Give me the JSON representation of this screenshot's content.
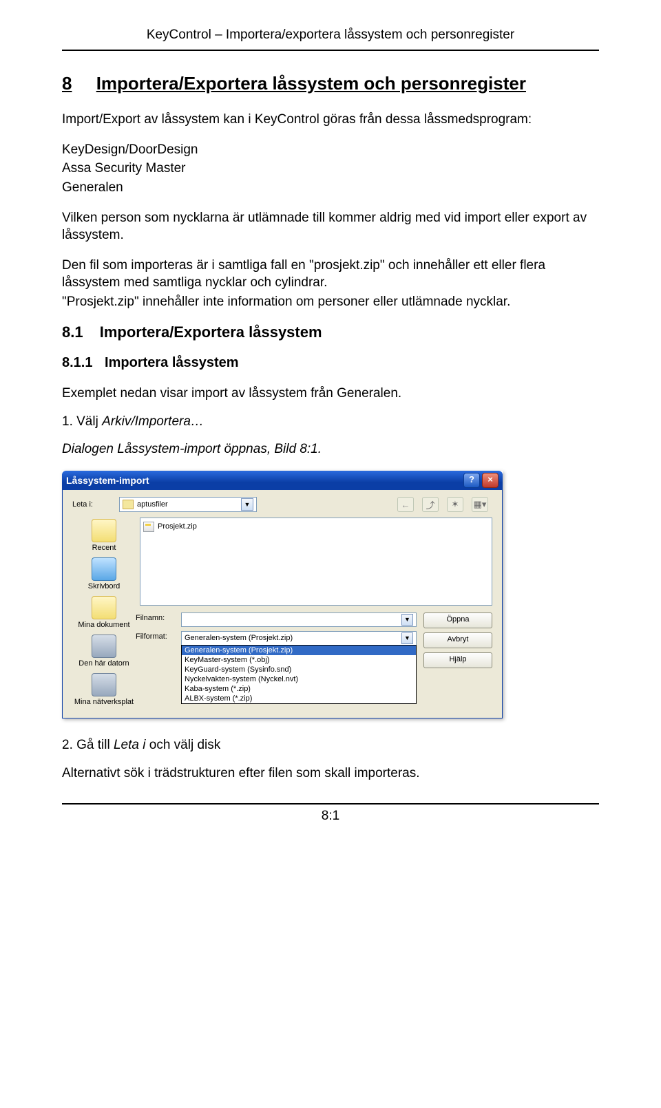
{
  "header": "KeyControl – Importera/exportera låssystem och personregister",
  "section": {
    "num": "8",
    "title": "Importera/Exportera låssystem och personregister"
  },
  "intro": "Import/Export av låssystem kan i KeyControl göras från dessa låssmedsprogram:",
  "programs": [
    "KeyDesign/DoorDesign",
    "Assa Security Master",
    "Generalen"
  ],
  "para2": "Vilken person som nycklarna är utlämnade till kommer aldrig med vid import eller export av låssystem.",
  "para3a": "Den fil som importeras är i samtliga fall en \"prosjekt.zip\" och innehåller ett eller flera låssystem med samtliga nycklar och cylindrar.",
  "para3b": "\"Prosjekt.zip\" innehåller inte information om personer eller utlämnade nycklar.",
  "h2": {
    "num": "8.1",
    "title": "Importera/Exportera låssystem"
  },
  "h3": {
    "num": "8.1.1",
    "title": "Importera låssystem"
  },
  "example": "Exemplet nedan visar import av låssystem från Generalen.",
  "step1_pre": "1.   Välj ",
  "step1_it": "Arkiv/Importera…",
  "caption_pre": "Dialogen ",
  "caption_it": "Låssystem-import",
  "caption_post": " öppnas, Bild 8:1.",
  "dialog": {
    "title": "Låssystem-import",
    "leta_label": "Leta i:",
    "leta_value": "aptusfiler",
    "sidebar": [
      "Recent",
      "Skrivbord",
      "Mina dokument",
      "Den här datorn",
      "Mina nätverksplat"
    ],
    "file": "Prosjekt.zip",
    "filnamn_label": "Filnamn:",
    "filformat_label": "Filformat:",
    "filformat_value": "Generalen-system (Prosjekt.zip)",
    "formats": [
      "Generalen-system (Prosjekt.zip)",
      "KeyMaster-system (*.obj)",
      "KeyGuard-system (Sysinfo.snd)",
      "Nyckelvakten-system (Nyckel.nvt)",
      "Kaba-system (*.zip)",
      "ALBX-system (*.zip)"
    ],
    "buttons": {
      "open": "Öppna",
      "cancel": "Avbryt",
      "help": "Hjälp"
    }
  },
  "step2_pre": "2.   Gå till ",
  "step2_it": "Leta i",
  "step2_post": " och välj disk",
  "alt": "Alternativt sök i trädstrukturen efter filen som skall importeras.",
  "pagenum": "8:1"
}
